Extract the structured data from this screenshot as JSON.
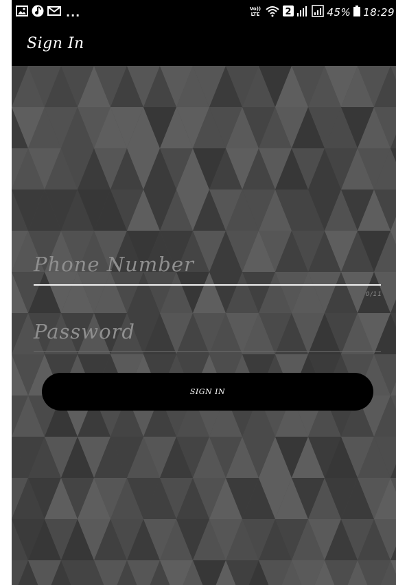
{
  "status_bar": {
    "notification_icons": [
      "image-icon",
      "music-note-icon",
      "mail-icon"
    ],
    "more_indicator": "...",
    "network_badge": "VoLTE",
    "sim_indicator": "2",
    "battery_percent": "45%",
    "time": "18:29"
  },
  "toolbar": {
    "title": "Sign In"
  },
  "form": {
    "phone": {
      "placeholder": "Phone Number",
      "counter": "0/11"
    },
    "password": {
      "placeholder": "Password"
    },
    "sign_in_label": "SIGN IN"
  },
  "colors": {
    "bar_background": "#000000",
    "content_background": "#4a4a4a",
    "placeholder_text": "#8f8f8f",
    "active_underline": "#f2f2f2",
    "button_background": "#000000"
  }
}
